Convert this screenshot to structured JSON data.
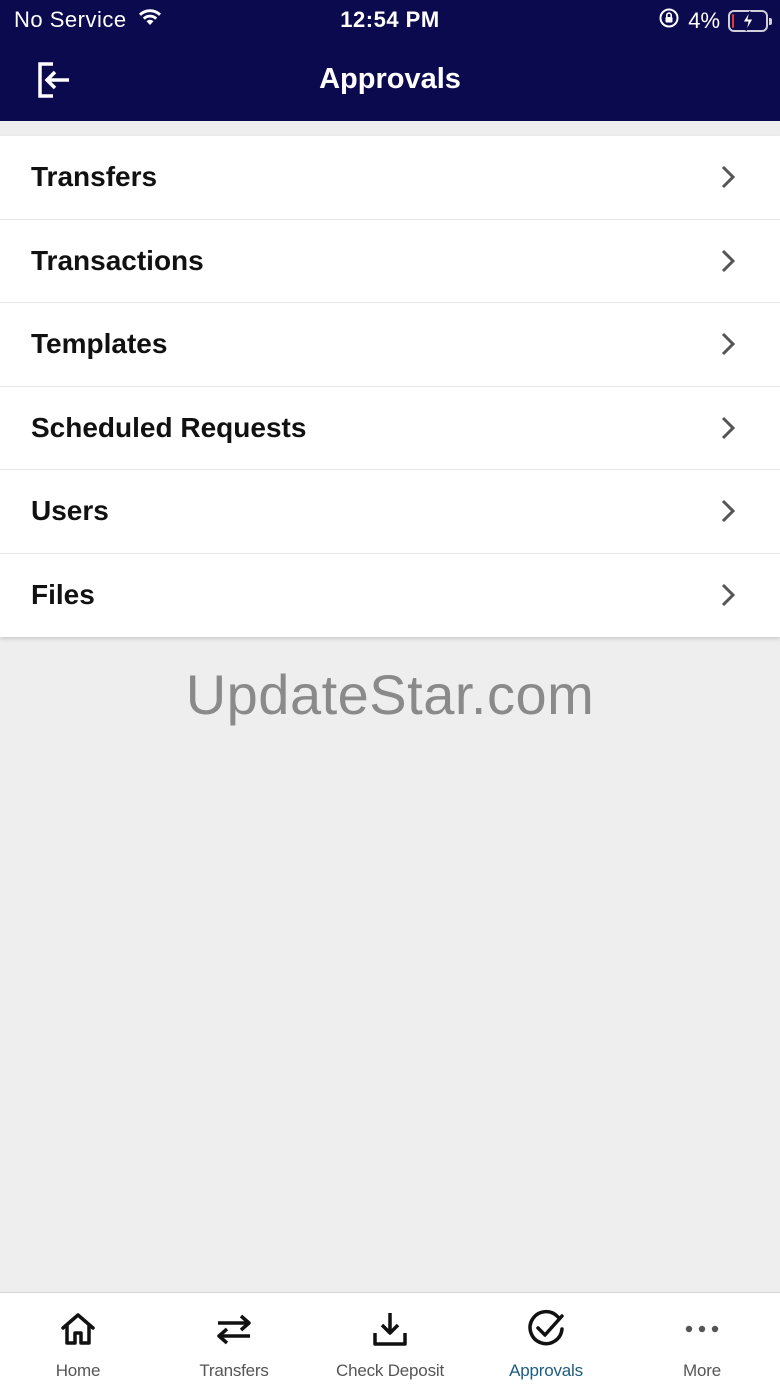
{
  "status_bar": {
    "carrier": "No Service",
    "time": "12:54 PM",
    "battery": "4%",
    "battery_level": 0.04
  },
  "header": {
    "title": "Approvals"
  },
  "menu": {
    "items": [
      {
        "label": "Transfers"
      },
      {
        "label": "Transactions"
      },
      {
        "label": "Templates"
      },
      {
        "label": "Scheduled Requests"
      },
      {
        "label": "Users"
      },
      {
        "label": "Files"
      }
    ]
  },
  "watermark": "UpdateStar.com",
  "tabbar": {
    "active": "Approvals",
    "items": [
      {
        "label": "Home",
        "icon": "home-icon"
      },
      {
        "label": "Transfers",
        "icon": "transfer-arrows-icon"
      },
      {
        "label": "Check Deposit",
        "icon": "download-tray-icon"
      },
      {
        "label": "Approvals",
        "icon": "check-circle-icon"
      },
      {
        "label": "More",
        "icon": "ellipsis-icon"
      }
    ]
  },
  "colors": {
    "header_bg": "#0c0a4f",
    "active_tab": "#1c5d80",
    "inactive_tab": "#555555",
    "battery_low": "#e53935"
  }
}
